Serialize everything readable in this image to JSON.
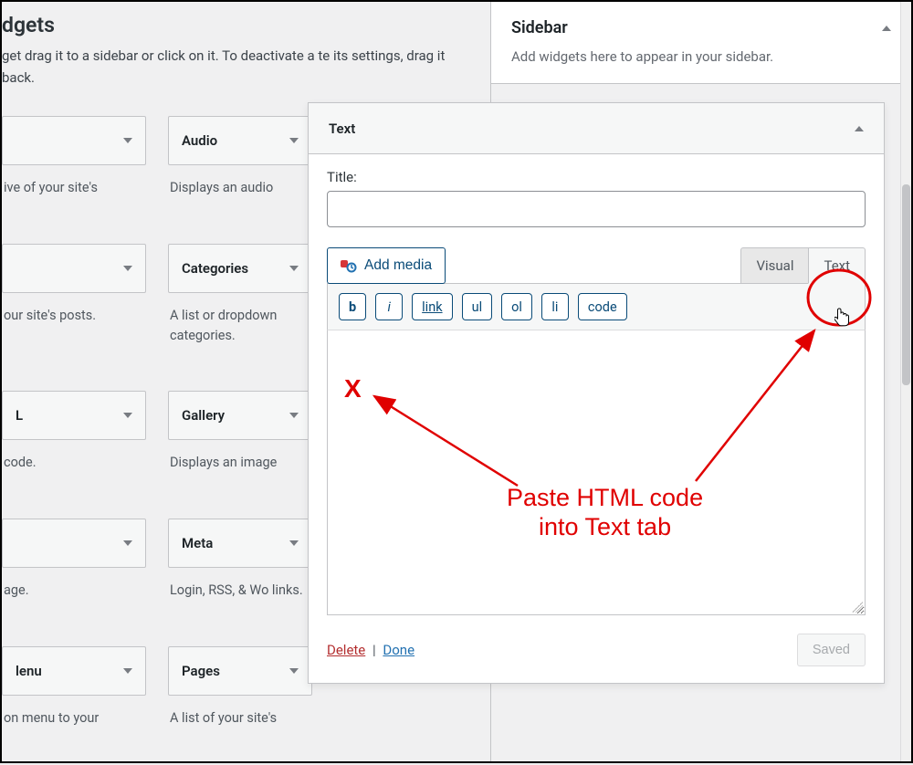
{
  "left": {
    "title_frag": "dgets",
    "desc": "get drag it to a sidebar or click on it. To deactivate a te its settings, drag it back.",
    "widgets": [
      {
        "name": "",
        "desc": "ive of your site's"
      },
      {
        "name": "Audio",
        "desc": "Displays an audio"
      },
      {
        "name": "",
        "desc": "our site's posts."
      },
      {
        "name": "Categories",
        "desc": "A list or dropdown categories."
      },
      {
        "name": "L",
        "desc": " code."
      },
      {
        "name": "Gallery",
        "desc": "Displays an image"
      },
      {
        "name": "",
        "desc": "age."
      },
      {
        "name": "Meta",
        "desc": "Login, RSS, & Wo links."
      },
      {
        "name": "lenu",
        "desc": "on menu to your"
      },
      {
        "name": "Pages",
        "desc": "A list of your site's"
      }
    ]
  },
  "sidebar": {
    "title": "Sidebar",
    "sub": "Add widgets here to appear in your sidebar."
  },
  "panel": {
    "header": "Text",
    "title_label": "Title:",
    "title_value": "",
    "add_media": "Add media",
    "tab_visual": "Visual",
    "tab_text": "Text",
    "toolbar": {
      "b": "b",
      "i": "i",
      "link": "link",
      "ul": "ul",
      "ol": "ol",
      "li": "li",
      "code": "code"
    },
    "editor_content": "",
    "delete": "Delete",
    "done": "Done",
    "saved": "Saved"
  },
  "annotation": {
    "marker": "X",
    "text_l1": "Paste HTML code",
    "text_l2": "into Text tab"
  }
}
